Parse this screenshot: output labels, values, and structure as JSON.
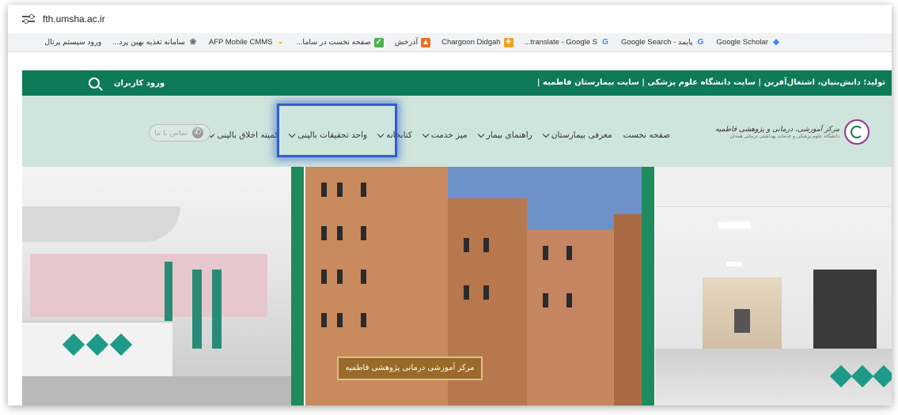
{
  "browser": {
    "url": "fth.umsha.ac.ir"
  },
  "bookmarks": [
    {
      "label": "Google Scholar",
      "icon": "scholar-icon",
      "color": "#4285f4"
    },
    {
      "label": "پایمد - Google Search",
      "icon": "google-icon",
      "color": "#4285f4"
    },
    {
      "label": "translate - Google S...",
      "icon": "google-icon",
      "color": "#4285f4"
    },
    {
      "label": "Chargoon Didgah",
      "icon": "chargoon-icon",
      "color": "#f0a020"
    },
    {
      "label": "آذرخش",
      "icon": "azarakhsh-icon",
      "color": "#f07020"
    },
    {
      "label": "صفحه نخست در ساما...",
      "icon": "sama-icon",
      "color": "#4caf50"
    },
    {
      "label": "AFP Mobile CMMS",
      "icon": "afp-icon",
      "color": "#f5c000"
    },
    {
      "label": "سامانه تغذیه بهین پرد...",
      "icon": "behin-icon",
      "color": "#666666"
    },
    {
      "label": "ورود سیستم پرتال",
      "icon": "portal-icon",
      "color": "#888888"
    }
  ],
  "top_bar": {
    "tagline": "تولید؛ دانش‌بنیان، اشتغال‌آفرین | سایت دانشگاه علوم پزشکی | سایت بیمارستان فاطمیه |",
    "login_label": "ورود کاربران",
    "color": "#0e7a58"
  },
  "logo": {
    "title": "مرکز آموزشی، درمانی و پژوهشی فاطمیه",
    "subtitle": "دانشگاه علوم پزشکی و خدمات بهداشتی درمانی همدان"
  },
  "menu": [
    {
      "label": "صفحه نخست",
      "chevron": false
    },
    {
      "label": "معرفی بیمارستان",
      "chevron": true
    },
    {
      "label": "راهنمای بیمار",
      "chevron": true
    },
    {
      "label": "میز خدمت",
      "chevron": true
    },
    {
      "label": "کتابخانه",
      "chevron": true
    },
    {
      "label": "واحد تحقیقات بالینی",
      "chevron": true
    },
    {
      "label": "کمیته اخلاق بالینی",
      "chevron": true
    }
  ],
  "contact": {
    "label": "تماس با ما"
  },
  "banner": {
    "building_sign": "مرکز آموزشی درمانی پژوهشی فاطمیه"
  }
}
